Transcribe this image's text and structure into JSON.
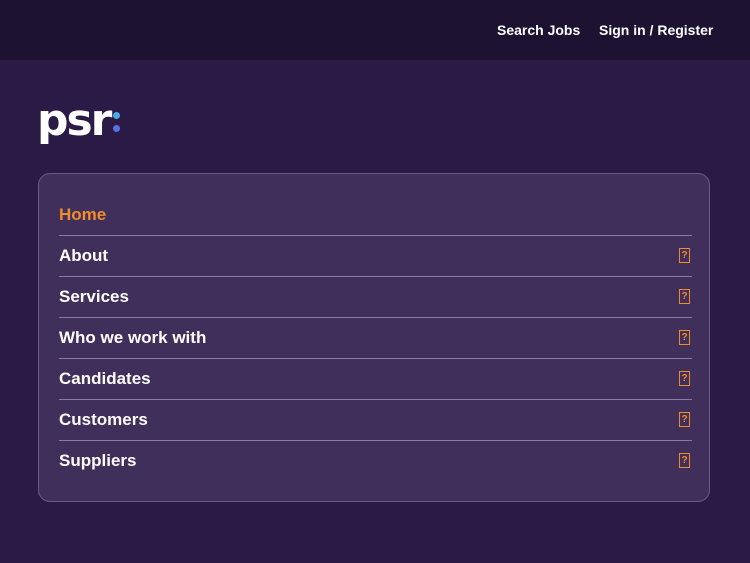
{
  "header": {
    "search_jobs": "Search Jobs",
    "sign_in": "Sign in / Register"
  },
  "logo": {
    "text": "psr",
    "dot_colors": [
      "#4aa7e8",
      "#5a6fe0"
    ]
  },
  "menu": {
    "items": [
      {
        "label": "Home",
        "active": true,
        "arrow": ""
      },
      {
        "label": "About",
        "active": false,
        "arrow": "?"
      },
      {
        "label": "Services",
        "active": false,
        "arrow": "?"
      },
      {
        "label": "Who we work with",
        "active": false,
        "arrow": "?"
      },
      {
        "label": "Candidates",
        "active": false,
        "arrow": "?"
      },
      {
        "label": "Customers",
        "active": false,
        "arrow": "?"
      },
      {
        "label": "Suppliers",
        "active": false,
        "arrow": "?"
      }
    ]
  },
  "colors": {
    "background": "#2b1a46",
    "topbar": "#1e1233",
    "panel": "#412f5b",
    "accent": "#f08c2a"
  }
}
